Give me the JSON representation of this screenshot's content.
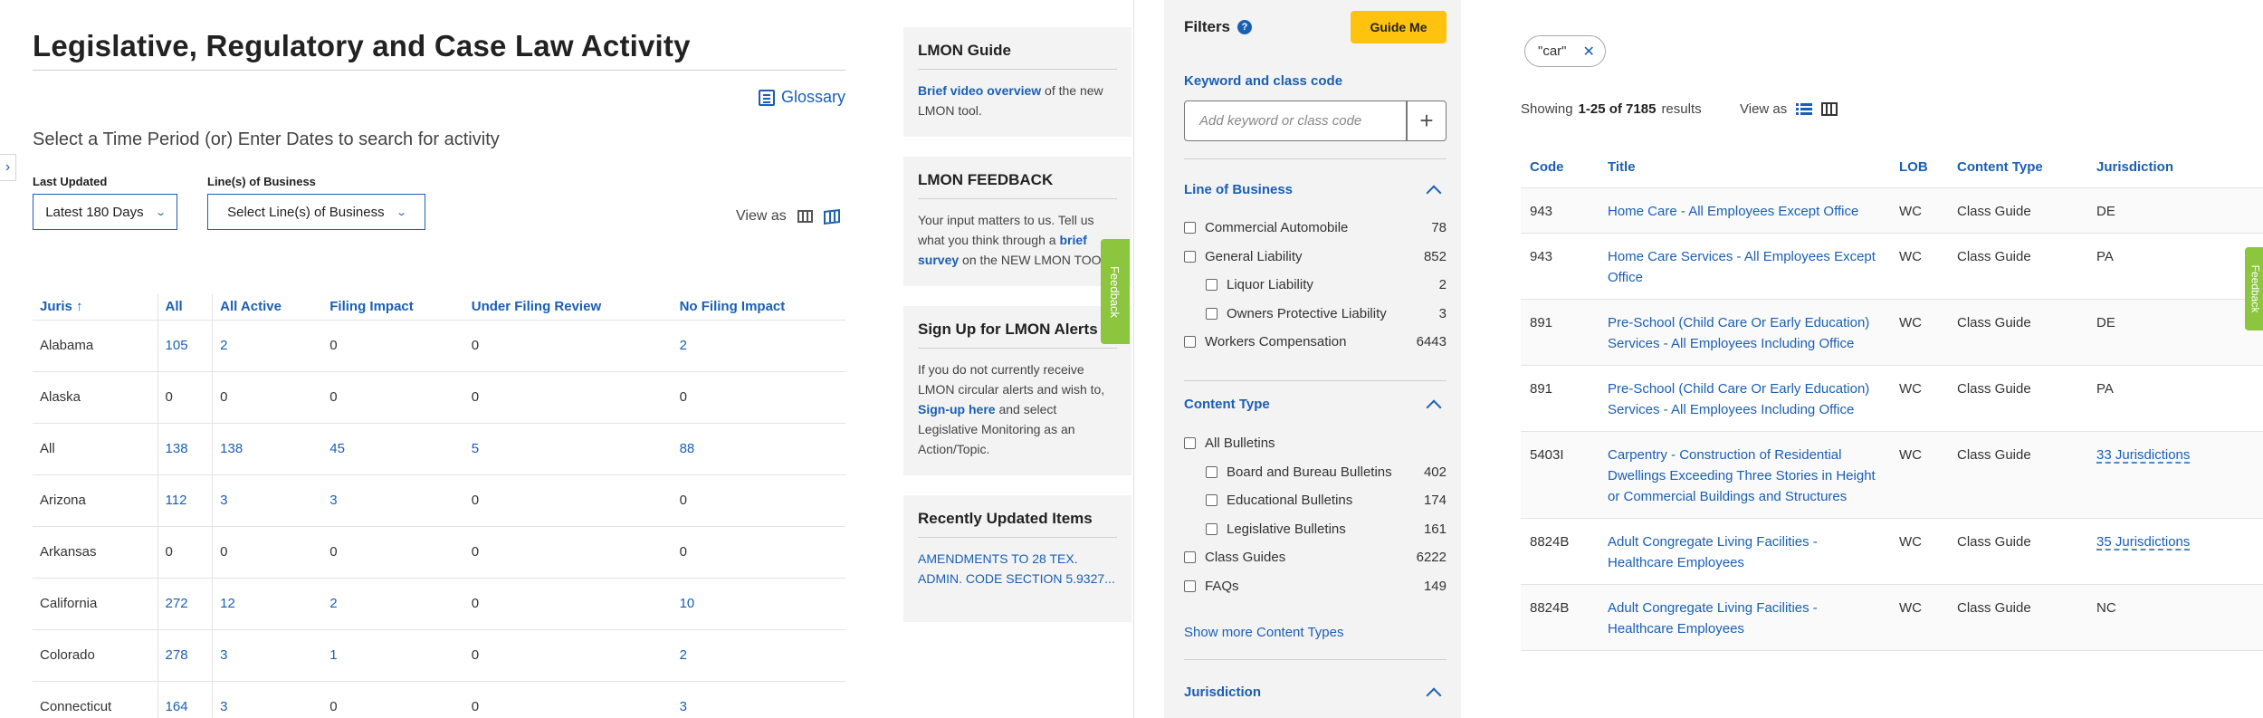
{
  "left": {
    "title": "Legislative, Regulatory and Case Law Activity",
    "glossary": "Glossary",
    "subhead": "Select a Time Period (or) Enter Dates to search for activity",
    "last_updated_label": "Last Updated",
    "last_updated_value": "Latest 180 Days",
    "lob_label": "Line(s) of Business",
    "lob_value": "Select Line(s) of Business",
    "view_as": "View as",
    "table": {
      "headers": [
        "Juris",
        "All",
        "All Active",
        "Filing Impact",
        "Under Filing Review",
        "No Filing Impact"
      ],
      "rows": [
        [
          "Alabama",
          "105",
          "2",
          "0",
          "0",
          "2"
        ],
        [
          "Alaska",
          "0",
          "0",
          "0",
          "0",
          "0"
        ],
        [
          "All",
          "138",
          "138",
          "45",
          "5",
          "88"
        ],
        [
          "Arizona",
          "112",
          "3",
          "3",
          "0",
          "0"
        ],
        [
          "Arkansas",
          "0",
          "0",
          "0",
          "0",
          "0"
        ],
        [
          "California",
          "272",
          "12",
          "2",
          "0",
          "10"
        ],
        [
          "Colorado",
          "278",
          "3",
          "1",
          "0",
          "2"
        ],
        [
          "Connecticut",
          "164",
          "3",
          "0",
          "0",
          "3"
        ]
      ]
    }
  },
  "lmon": {
    "guide_title": "LMON Guide",
    "guide_link": "Brief video overview",
    "guide_text": " of the new LMON tool.",
    "feedback_title": "LMON FEEDBACK",
    "feedback_text1": "Your input matters to us. Tell us what you think through a ",
    "feedback_link": "brief survey",
    "feedback_text2": " on the NEW LMON TOOL.",
    "alerts_title": "Sign Up for LMON Alerts",
    "alerts_text1": "If you do not currently receive LMON circular alerts and wish to, ",
    "alerts_link": "Sign-up here",
    "alerts_text2": " and select Legislative Monitoring as an Action/Topic.",
    "recent_title": "Recently Updated Items",
    "recent_item": "AMENDMENTS TO 28 TEX. ADMIN. CODE SECTION 5.9327...",
    "feedback_tab": "Feedback"
  },
  "filters": {
    "title": "Filters",
    "guide_button": "Guide Me",
    "keyword_title": "Keyword and class code",
    "keyword_placeholder": "Add keyword or class code",
    "lob_title": "Line of Business",
    "lob_items": [
      {
        "label": "Commercial Automobile",
        "count": "78"
      },
      {
        "label": "General Liability",
        "count": "852"
      },
      {
        "label": "Liquor Liability",
        "count": "2"
      },
      {
        "label": "Owners Protective Liability",
        "count": "3"
      },
      {
        "label": "Workers Compensation",
        "count": "6443"
      }
    ],
    "content_title": "Content Type",
    "content_items": [
      {
        "label": "All Bulletins",
        "count": ""
      },
      {
        "label": "Board and Bureau Bulletins",
        "count": "402"
      },
      {
        "label": "Educational Bulletins",
        "count": "174"
      },
      {
        "label": "Legislative Bulletins",
        "count": "161"
      },
      {
        "label": "Class Guides",
        "count": "6222"
      },
      {
        "label": "FAQs",
        "count": "149"
      }
    ],
    "show_more": "Show more Content Types",
    "jurisdiction_title": "Jurisdiction"
  },
  "results": {
    "chip": "\"car\"",
    "showing_prefix": "Showing",
    "showing_range": "1-25 of 7185",
    "showing_suffix": "results",
    "view_as": "View as",
    "headers": [
      "Code",
      "Title",
      "LOB",
      "Content Type",
      "Jurisdiction"
    ],
    "rows": [
      [
        "943",
        "Home Care - All Employees Except Office",
        "WC",
        "Class Guide",
        "DE"
      ],
      [
        "943",
        "Home Care Services - All Employees Except Office",
        "WC",
        "Class Guide",
        "PA"
      ],
      [
        "891",
        "Pre-School (Child Care Or Early Education) Services - All Employees Including Office",
        "WC",
        "Class Guide",
        "DE"
      ],
      [
        "891",
        "Pre-School (Child Care Or Early Education) Services - All Employees Including Office",
        "WC",
        "Class Guide",
        "PA"
      ],
      [
        "5403I",
        "Carpentry - Construction of Residential Dwellings Exceeding Three Stories in Height or Commercial Buildings and Structures",
        "WC",
        "Class Guide",
        "33 Jurisdictions"
      ],
      [
        "8824B",
        "Adult Congregate Living Facilities - Healthcare Employees",
        "WC",
        "Class Guide",
        "35 Jurisdictions"
      ],
      [
        "8824B",
        "Adult Congregate Living Facilities - Healthcare Employees",
        "WC",
        "Class Guide",
        "NC"
      ]
    ],
    "feedback_tab": "Feedback"
  }
}
